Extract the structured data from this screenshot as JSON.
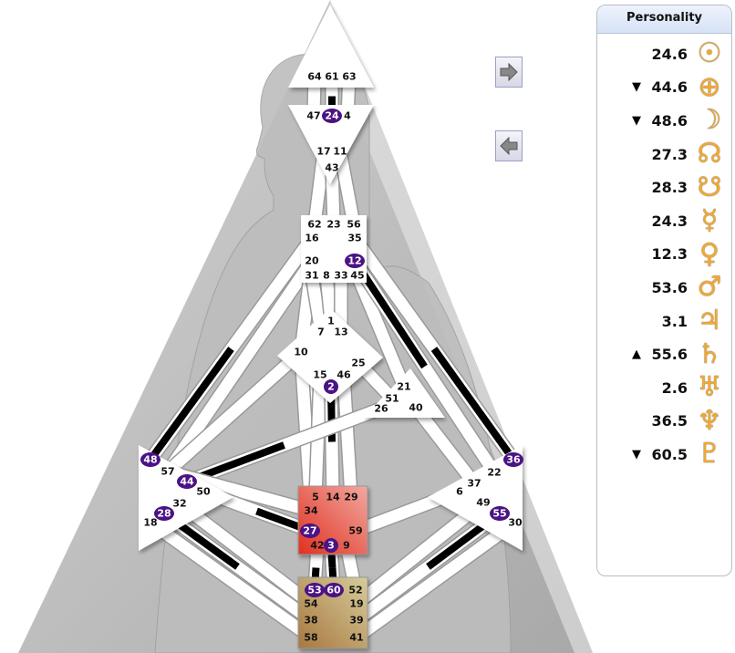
{
  "colors": {
    "defined_gate": "#4b1384",
    "sacral": "#e8473a",
    "root": "#b08a4e",
    "channel_active": "#000000",
    "planet_glyph": "#f3a92e"
  },
  "nav": {
    "next_icon": "arrow-right-icon",
    "prev_icon": "arrow-left-icon"
  },
  "centers": [
    {
      "name": "head",
      "gates": [
        {
          "n": 64
        },
        {
          "n": 61
        },
        {
          "n": 63
        }
      ]
    },
    {
      "name": "ajna",
      "gates": [
        {
          "n": 47
        },
        {
          "n": 24,
          "active": true
        },
        {
          "n": 4
        },
        {
          "n": 17
        },
        {
          "n": 11
        },
        {
          "n": 43
        }
      ]
    },
    {
      "name": "throat",
      "gates": [
        {
          "n": 62
        },
        {
          "n": 23
        },
        {
          "n": 56
        },
        {
          "n": 16
        },
        {
          "n": 35
        },
        {
          "n": 20
        },
        {
          "n": 12,
          "active": true
        },
        {
          "n": 31
        },
        {
          "n": 8
        },
        {
          "n": 33
        },
        {
          "n": 45
        }
      ]
    },
    {
      "name": "g",
      "gates": [
        {
          "n": 1
        },
        {
          "n": 7
        },
        {
          "n": 13
        },
        {
          "n": 10
        },
        {
          "n": 25
        },
        {
          "n": 15
        },
        {
          "n": 46
        },
        {
          "n": 2,
          "active": true
        }
      ]
    },
    {
      "name": "heart",
      "gates": [
        {
          "n": 21
        },
        {
          "n": 51
        },
        {
          "n": 26
        },
        {
          "n": 40
        }
      ]
    },
    {
      "name": "spleen",
      "gates": [
        {
          "n": 48,
          "active": true
        },
        {
          "n": 57
        },
        {
          "n": 44,
          "active": true
        },
        {
          "n": 50
        },
        {
          "n": 32
        },
        {
          "n": 28,
          "active": true
        },
        {
          "n": 18
        }
      ]
    },
    {
      "name": "solar-plexus",
      "gates": [
        {
          "n": 36,
          "active": true
        },
        {
          "n": 22
        },
        {
          "n": 37
        },
        {
          "n": 6
        },
        {
          "n": 49
        },
        {
          "n": 55,
          "active": true
        },
        {
          "n": 30
        }
      ]
    },
    {
      "name": "sacral",
      "defined": true,
      "gates": [
        {
          "n": 5
        },
        {
          "n": 14
        },
        {
          "n": 29
        },
        {
          "n": 34
        },
        {
          "n": 27,
          "active": true
        },
        {
          "n": 59
        },
        {
          "n": 42
        },
        {
          "n": 3,
          "active": true
        },
        {
          "n": 9
        }
      ]
    },
    {
      "name": "root",
      "defined": true,
      "gates": [
        {
          "n": 53,
          "active": true
        },
        {
          "n": 60,
          "active": true
        },
        {
          "n": 52
        },
        {
          "n": 54
        },
        {
          "n": 19
        },
        {
          "n": 38
        },
        {
          "n": 39
        },
        {
          "n": 58
        },
        {
          "n": 41
        }
      ]
    }
  ],
  "channels": [
    {
      "g": [
        64,
        47
      ]
    },
    {
      "g": [
        61,
        24
      ],
      "active": [
        24
      ]
    },
    {
      "g": [
        63,
        4
      ]
    },
    {
      "g": [
        17,
        62
      ]
    },
    {
      "g": [
        43,
        23
      ]
    },
    {
      "g": [
        11,
        56
      ]
    },
    {
      "g": [
        16,
        48
      ],
      "active": [
        48
      ]
    },
    {
      "g": [
        20,
        57
      ]
    },
    {
      "g": [
        20,
        34
      ]
    },
    {
      "g": [
        20,
        10
      ]
    },
    {
      "g": [
        31,
        7
      ]
    },
    {
      "g": [
        8,
        1
      ]
    },
    {
      "g": [
        33,
        13
      ]
    },
    {
      "g": [
        45,
        21
      ]
    },
    {
      "g": [
        12,
        22
      ],
      "active": [
        12
      ]
    },
    {
      "g": [
        35,
        36
      ],
      "active": [
        36
      ]
    },
    {
      "g": [
        10,
        57
      ]
    },
    {
      "g": [
        10,
        34
      ]
    },
    {
      "g": [
        15,
        5
      ]
    },
    {
      "g": [
        2,
        14
      ],
      "active": [
        2
      ]
    },
    {
      "g": [
        46,
        29
      ]
    },
    {
      "g": [
        25,
        51
      ]
    },
    {
      "g": [
        26,
        44
      ],
      "active": [
        44
      ]
    },
    {
      "g": [
        40,
        37
      ]
    },
    {
      "g": [
        34,
        57
      ]
    },
    {
      "g": [
        27,
        50
      ],
      "active": [
        27
      ]
    },
    {
      "g": [
        59,
        6
      ]
    },
    {
      "g": [
        42,
        53
      ],
      "active": [
        53
      ]
    },
    {
      "g": [
        3,
        60
      ],
      "active": [
        3,
        60
      ]
    },
    {
      "g": [
        9,
        52
      ]
    },
    {
      "g": [
        54,
        32
      ]
    },
    {
      "g": [
        38,
        28
      ],
      "active": [
        28
      ]
    },
    {
      "g": [
        58,
        18
      ]
    },
    {
      "g": [
        19,
        49
      ]
    },
    {
      "g": [
        39,
        55
      ],
      "active": [
        55
      ]
    },
    {
      "g": [
        41,
        30
      ]
    }
  ],
  "personality": {
    "title": "Personality",
    "rows": [
      {
        "planet": "sun",
        "symbol": "☉",
        "arrow": "",
        "value": "24.6"
      },
      {
        "planet": "earth",
        "symbol": "⊕",
        "arrow": "▼",
        "value": "44.6"
      },
      {
        "planet": "moon",
        "symbol": "☽",
        "arrow": "▼",
        "value": "48.6"
      },
      {
        "planet": "north-node",
        "symbol": "☊",
        "arrow": "",
        "value": "27.3"
      },
      {
        "planet": "south-node",
        "symbol": "☋",
        "arrow": "",
        "value": "28.3"
      },
      {
        "planet": "mercury",
        "symbol": "☿",
        "arrow": "",
        "value": "24.3"
      },
      {
        "planet": "venus",
        "symbol": "♀",
        "arrow": "",
        "value": "12.3"
      },
      {
        "planet": "mars",
        "symbol": "♂",
        "arrow": "",
        "value": "53.6"
      },
      {
        "planet": "jupiter",
        "symbol": "♃",
        "arrow": "",
        "value": "3.1"
      },
      {
        "planet": "saturn",
        "symbol": "♄",
        "arrow": "▲",
        "value": "55.6"
      },
      {
        "planet": "uranus",
        "symbol": "♅",
        "arrow": "",
        "value": "2.6"
      },
      {
        "planet": "neptune",
        "symbol": "♆",
        "arrow": "",
        "value": "36.5"
      },
      {
        "planet": "pluto",
        "symbol": "♇",
        "arrow": "▼",
        "value": "60.5"
      }
    ]
  }
}
